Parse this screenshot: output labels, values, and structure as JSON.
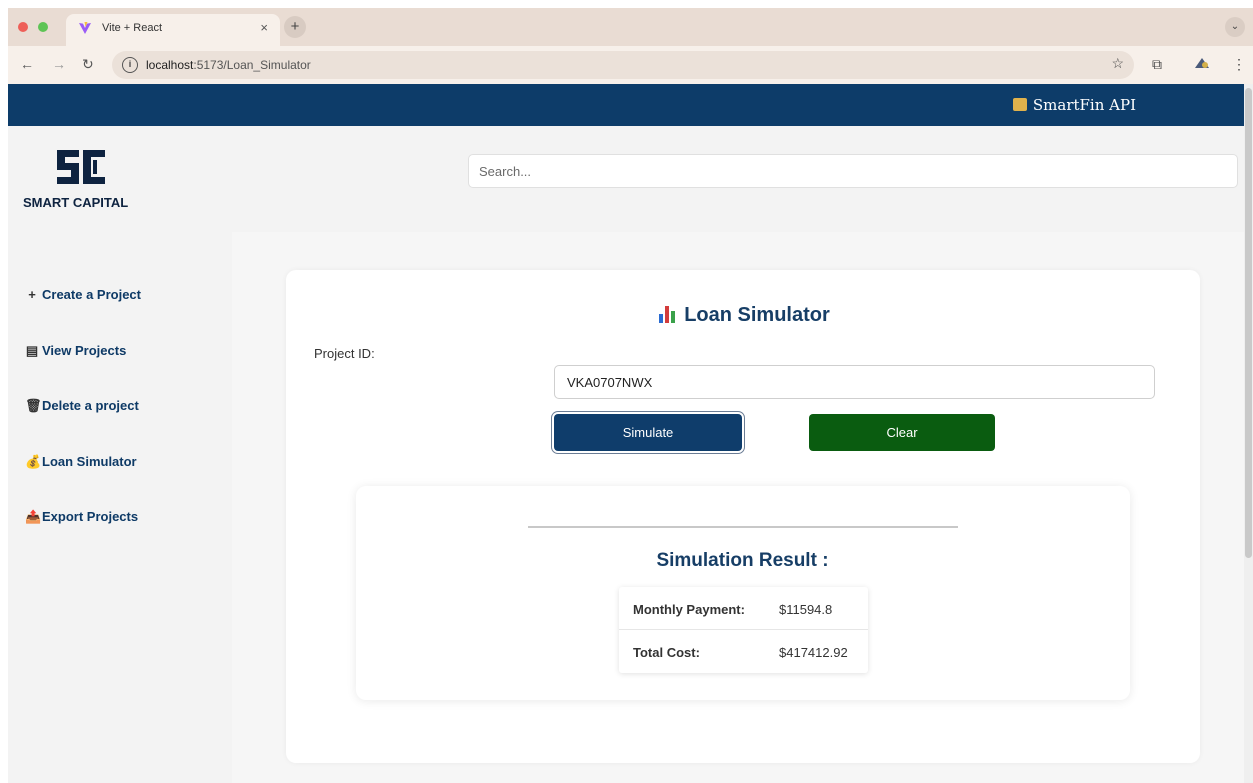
{
  "browser": {
    "tab_title": "Vite + React",
    "tab_close": "×",
    "new_tab": "+",
    "url": "localhost:5173/Loan_Simulator",
    "url_host": "localhost",
    "url_path": ":5173/Loan_Simulator"
  },
  "header": {
    "brand": "SmartFin API"
  },
  "logo": {
    "text": "SMART CAPITAL"
  },
  "search": {
    "placeholder": "Search..."
  },
  "sidebar": {
    "items": [
      {
        "icon": "+",
        "label": "Create a Project"
      },
      {
        "icon": "▤",
        "label": "View Projects"
      },
      {
        "icon": "🗑",
        "label": "Delete a project"
      },
      {
        "icon": "💰",
        "label": "Loan Simulator"
      },
      {
        "icon": "📤",
        "label": "Export Projects"
      }
    ]
  },
  "simulator": {
    "title": "Loan Simulator",
    "project_id_label": "Project ID:",
    "project_id_value": "VKA0707NWX",
    "simulate_label": "Simulate",
    "clear_label": "Clear"
  },
  "result": {
    "title": "Simulation Result :",
    "rows": [
      {
        "key": "Monthly Payment:",
        "value": "$11594.8"
      },
      {
        "key": "Total Cost:",
        "value": "$417412.92"
      }
    ]
  },
  "colors": {
    "primary": "#0d3c69",
    "clear_button": "#0a5c10",
    "title_text": "#173e66"
  }
}
